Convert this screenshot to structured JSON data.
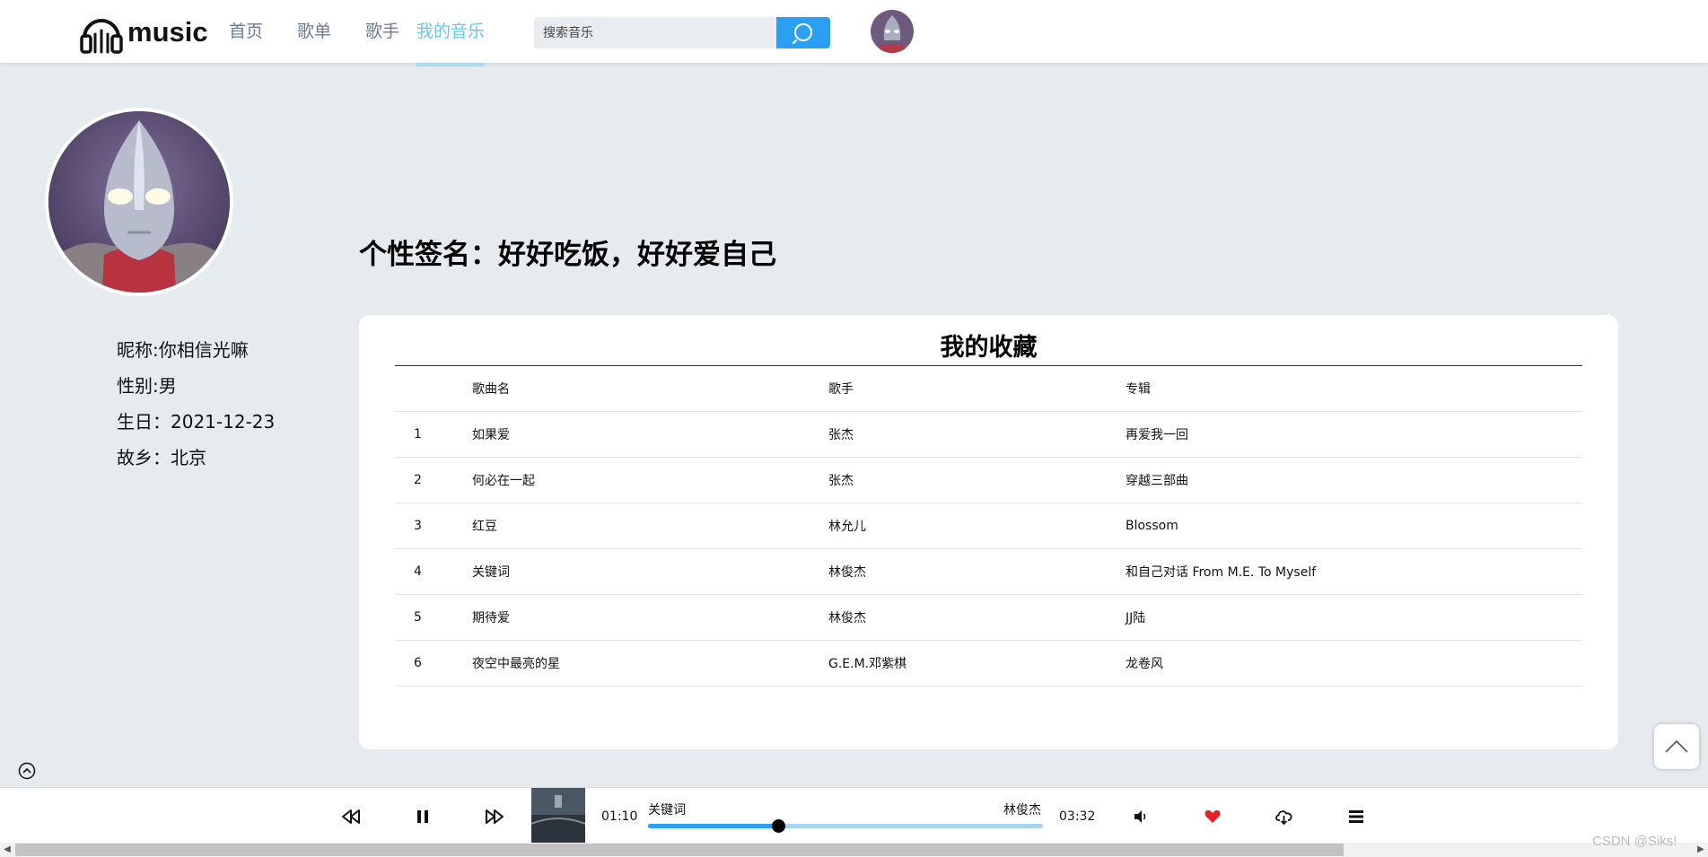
{
  "header": {
    "logo_text": "music",
    "nav": [
      {
        "label": "首页",
        "active": false
      },
      {
        "label": "歌单",
        "active": false
      },
      {
        "label": "歌手",
        "active": false
      },
      {
        "label": "我的音乐",
        "active": true
      }
    ],
    "search_placeholder": "搜索音乐"
  },
  "profile": {
    "nickname": "昵称:你相信光嘛",
    "gender": "性别:男",
    "birthday": "生日：2021-12-23",
    "hometown": "故乡：北京",
    "signature": "个性签名：好好吃饭，好好爱自己"
  },
  "favorites": {
    "title": "我的收藏",
    "columns": [
      "",
      "歌曲名",
      "歌手",
      "专辑"
    ],
    "rows": [
      [
        "1",
        "如果爱",
        "张杰",
        "再爱我一回"
      ],
      [
        "2",
        "何必在一起",
        "张杰",
        "穿越三部曲"
      ],
      [
        "3",
        "红豆",
        "林允儿",
        "Blossom"
      ],
      [
        "4",
        "关键词",
        "林俊杰",
        "和自己对话 From M.E. To Myself"
      ],
      [
        "5",
        "期待爱",
        "林俊杰",
        "JJ陆"
      ],
      [
        "6",
        "夜空中最亮的星",
        "G.E.M.邓紫棋",
        "龙卷风"
      ]
    ]
  },
  "player": {
    "current_time": "01:10",
    "total_time": "03:32",
    "song": "关键词",
    "artist": "林俊杰",
    "progress": 0.33,
    "liked_color": "#e8202a"
  },
  "watermark": "CSDN @Siks!",
  "colors": {
    "accent": "#2b9ff3",
    "nav_active": "#67c7ee",
    "background": "#e6ebef"
  }
}
